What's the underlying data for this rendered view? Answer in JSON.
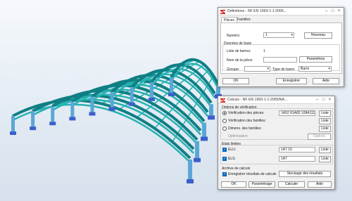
{
  "definitions": {
    "title": "Définitions - NF EN 1993-1-1:2005...",
    "tabs": [
      "Pièces",
      "Familles"
    ],
    "numero_label": "Numéro:",
    "numero_value": "1",
    "nouveau_button": "Nouveau",
    "donnees_label": "Données de base",
    "liste_barres_label": "Liste de barres:",
    "liste_barres_value": "1",
    "nom_piece_label": "Nom de la pièce:",
    "nom_piece_value": "",
    "parametres_button": "Paramètres",
    "groupe_label": "Groupe:",
    "groupe_value": "",
    "type_barre_label": "Type de barre:",
    "type_barre_value": "Barre",
    "ok_button": "OK",
    "enregistrer_button": "Enregistrer",
    "aide_button": "Aide"
  },
  "calculs": {
    "title": "Calculs - NF EN 1993-1-1:2005/NA...",
    "options_label": "Options de vérification",
    "verif_pieces_label": "Vérification des pièces:",
    "verif_pieces_value": "1A52 81A83 108A111 1",
    "verif_familles_label": "Vérification des familles:",
    "dimens_familles_label": "Dimens. des familles:",
    "liste_label": "Liste",
    "optimisation_label": "Optimisation",
    "options_button": "Options",
    "etats_limites_label": "Etats limites",
    "elu_label": "ELU:",
    "elu_value": "1A7 10",
    "els_label": "ELS:",
    "els_value": "1A7",
    "archive_label": "Archive de calculs",
    "enregistrer_resultats_label": "Enregistrer résultats de calculs",
    "stockage_button": "Stockage des résultats",
    "ok_button": "OK",
    "parametrage_button": "Paramétrage",
    "calculer_button": "Calculer",
    "aide_button": "Aide"
  },
  "icons": {
    "app": "robot-app-icon",
    "minimize": "minimize-icon",
    "maximize": "maximize-icon",
    "close": "close-icon"
  },
  "colors": {
    "structure": "#27b2b2",
    "structure_dark": "#0f7f84",
    "column": "#5aa7d6",
    "base_plate": "#3d5fcc",
    "app_icon": "#d42a2a",
    "check": "#0067c0"
  }
}
